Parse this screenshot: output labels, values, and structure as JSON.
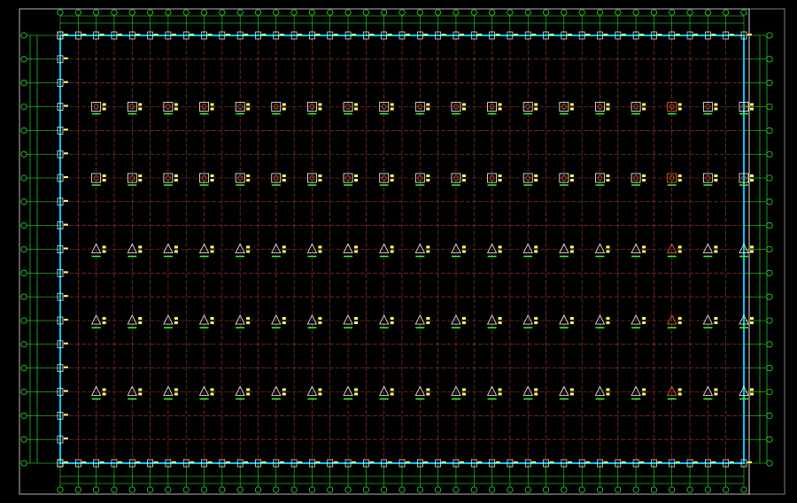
{
  "drawing": {
    "background": "#000000",
    "colors": {
      "grid_line": "#b03a2e",
      "frame": "#ffffff",
      "bubble": "#32ff32",
      "outline": "#00c8ff",
      "column": "#ffffff",
      "highlight": "#ff6a3a",
      "label": "#ffff66",
      "dim_line": "#32ff32"
    },
    "column_axes": {
      "count": 39
    },
    "row_axes": {
      "count": 19
    },
    "caption": ""
  }
}
